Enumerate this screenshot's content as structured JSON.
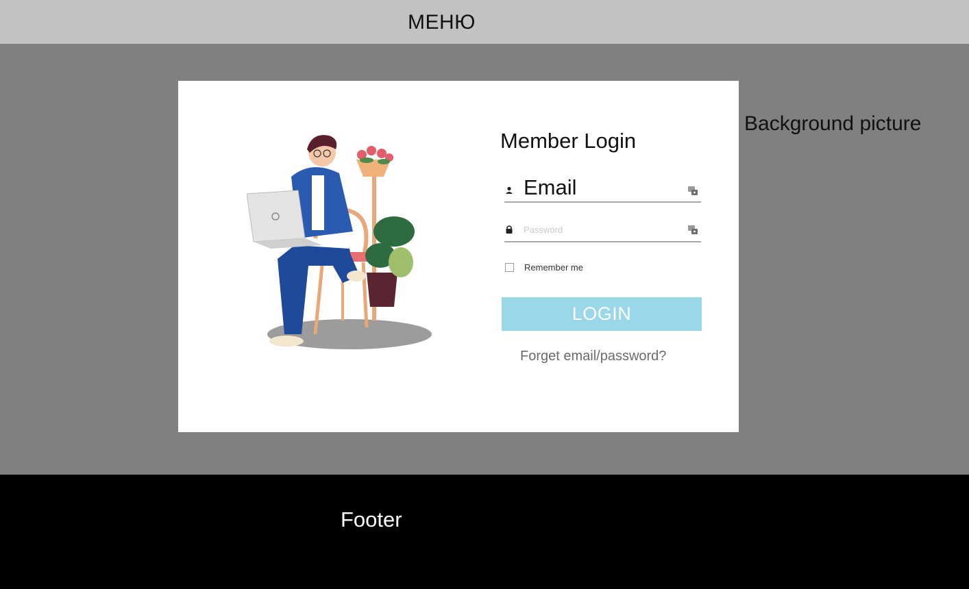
{
  "menu": {
    "label": "МЕНЮ"
  },
  "background": {
    "label": "Background picture"
  },
  "login": {
    "title": "Member Login",
    "email_value": "Email",
    "password_placeholder": "Password",
    "remember_label": "Remember me",
    "remember_checked": false,
    "button_label": "LOGIN",
    "forgot_label": "Forget email/password?",
    "button_color": "#9ad7e8"
  },
  "footer": {
    "label": "Footer"
  },
  "icons": {
    "illustration": "person-with-laptop-illustration",
    "email_left": "user-icon",
    "password_left": "lock-icon",
    "field_right": "key-icon"
  }
}
